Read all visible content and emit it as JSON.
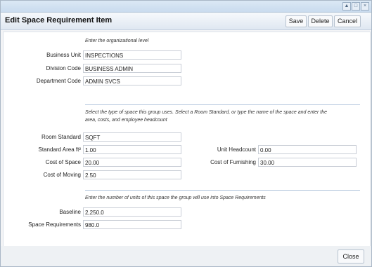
{
  "window_controls": [
    "▲",
    "□",
    "×"
  ],
  "header": {
    "title": "Edit Space Requirement Item",
    "save_label": "Save",
    "delete_label": "Delete",
    "cancel_label": "Cancel"
  },
  "section_org": {
    "note": "Enter the organizational level",
    "fields": [
      {
        "label": "Business Unit",
        "value": "INSPECTIONS"
      },
      {
        "label": "Division Code",
        "value": "BUSINESS ADMIN"
      },
      {
        "label": "Department Code",
        "value": "ADMIN SVCS"
      }
    ]
  },
  "section_space": {
    "note_line1": "Select the type of space this group uses. Select a Room Standard, or type the name of the space and enter the",
    "note_line2": "area, costs, and employee headcount",
    "room_standard": {
      "label": "Room Standard",
      "value": "SQFT"
    },
    "standard_area": {
      "label": "Standard Area ft²",
      "value": "1.00"
    },
    "cost_of_space": {
      "label": "Cost of Space",
      "value": "20.00"
    },
    "cost_of_moving": {
      "label": "Cost of Moving",
      "value": "2.50"
    },
    "unit_headcount": {
      "label": "Unit Headcount",
      "value": "0.00"
    },
    "cost_of_furnishing": {
      "label": "Cost of Furnishing",
      "value": "30.00"
    }
  },
  "section_units": {
    "note": "Enter the number of units of this space the group will use into Space Requirements",
    "baseline": {
      "label": "Baseline",
      "value": "2,250.0"
    },
    "space_requirements": {
      "label": "Space Requirements",
      "value": "980.0"
    }
  },
  "footer": {
    "close_label": "Close"
  }
}
